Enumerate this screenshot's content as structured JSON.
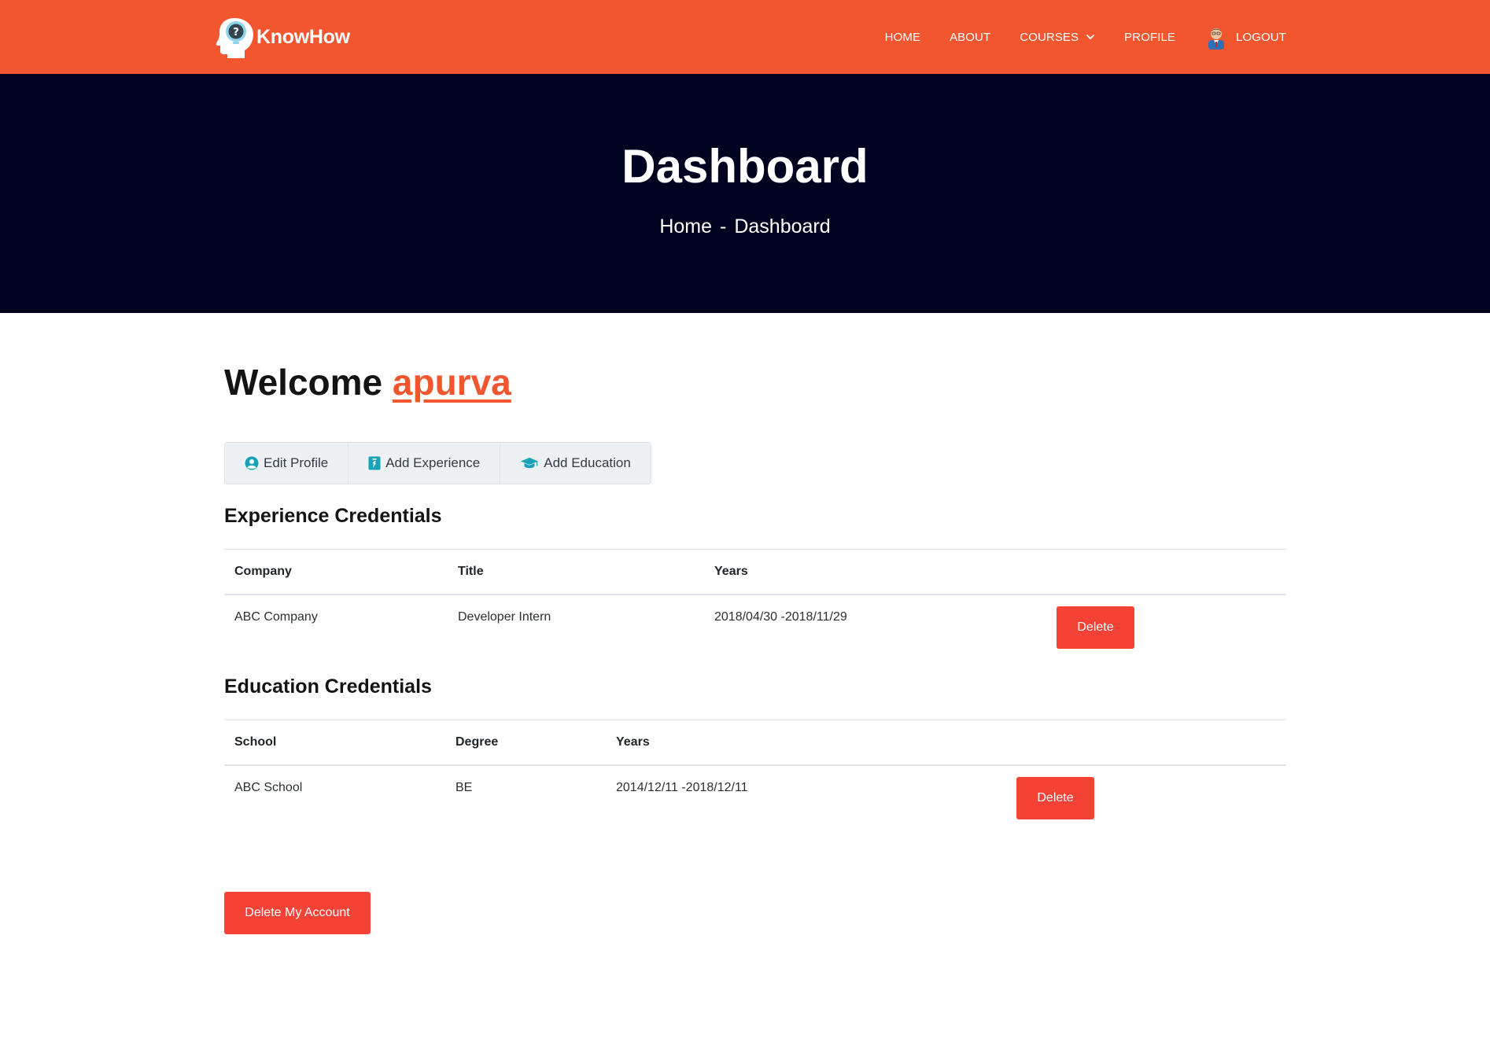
{
  "brand": {
    "name": "KnowHow"
  },
  "nav": {
    "home": "HOME",
    "about": "ABOUT",
    "courses": "COURSES",
    "profile": "PROFILE",
    "logout": "LOGOUT"
  },
  "hero": {
    "title": "Dashboard",
    "breadcrumb": [
      "Home",
      "-",
      "Dashboard"
    ]
  },
  "welcome": {
    "prefix": "Welcome",
    "username": "apurva"
  },
  "actions": {
    "edit_profile": "Edit Profile",
    "add_experience": "Add Experience",
    "add_education": "Add Education"
  },
  "experience": {
    "title": "Experience Credentials",
    "headers": [
      "Company",
      "Title",
      "Years"
    ],
    "rows": [
      {
        "company": "ABC Company",
        "title": "Developer Intern",
        "years": "2018/04/30 -2018/11/29",
        "action": "Delete"
      }
    ]
  },
  "education": {
    "title": "Education Credentials",
    "headers": [
      "School",
      "Degree",
      "Years"
    ],
    "rows": [
      {
        "school": "ABC School",
        "degree": "BE",
        "years": "2014/12/11 -2018/12/11",
        "action": "Delete"
      }
    ]
  },
  "delete_account": "Delete My Account",
  "colors": {
    "header": "#f1562f",
    "hero": "#00031f",
    "danger": "#f44336",
    "icon_accent": "#17a2b8"
  }
}
